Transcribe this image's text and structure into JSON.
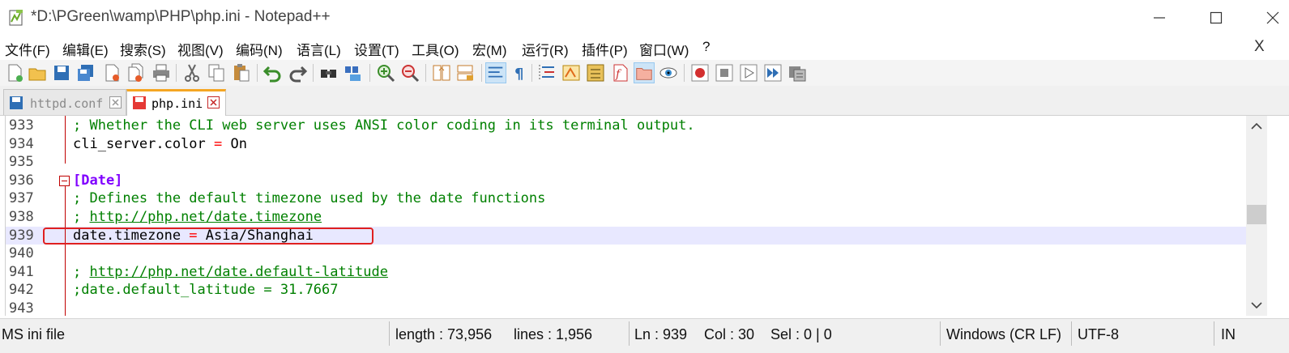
{
  "window": {
    "title": "*D:\\PGreen\\wamp\\PHP\\php.ini - Notepad++",
    "minimize_glyph": "—",
    "maximize_glyph": "☐",
    "close_glyph": "✕"
  },
  "menu": {
    "items": [
      "文件(F)",
      "编辑(E)",
      "搜索(S)",
      "视图(V)",
      "编码(N)",
      "语言(L)",
      "设置(T)",
      "工具(O)",
      "宏(M)",
      "运行(R)",
      "插件(P)",
      "窗口(W)",
      "?"
    ],
    "close_label": "X"
  },
  "toolbar": {
    "buttons": [
      "new-file-icon",
      "open-file-icon",
      "save-icon",
      "save-all-icon",
      "close-icon",
      "close-all-icon",
      "print-icon",
      "cut-icon",
      "copy-icon",
      "paste-icon",
      "undo-icon",
      "redo-icon",
      "find-icon",
      "replace-icon",
      "zoom-in-icon",
      "zoom-out-icon",
      "sync-vertical-icon",
      "sync-horizontal-icon",
      "word-wrap-icon",
      "show-all-chars-icon",
      "indent-guide-icon",
      "user-language-icon",
      "function-list-icon",
      "document-map-icon",
      "folder-workspace-icon",
      "monitoring-icon",
      "record-macro-icon",
      "stop-macro-icon",
      "play-macro-icon",
      "run-macro-multiple-icon",
      "save-macro-icon"
    ]
  },
  "tabs": [
    {
      "label": "httpd.conf",
      "active": false
    },
    {
      "label": "php.ini",
      "active": true
    }
  ],
  "editor": {
    "lines": [
      {
        "num": "933",
        "parts": [
          {
            "t": "; Whether the CLI web server uses ANSI color coding in its terminal output.",
            "c": "c-comment"
          }
        ]
      },
      {
        "num": "934",
        "parts": [
          {
            "t": "cli_server.color ",
            "c": "c-key"
          },
          {
            "t": "=",
            "c": "c-eq"
          },
          {
            "t": " On",
            "c": "c-val"
          }
        ]
      },
      {
        "num": "935",
        "parts": []
      },
      {
        "num": "936",
        "parts": [
          {
            "t": "[Date]",
            "c": "c-section"
          }
        ]
      },
      {
        "num": "937",
        "parts": [
          {
            "t": "; Defines the default timezone used by the date functions",
            "c": "c-comment"
          }
        ]
      },
      {
        "num": "938",
        "parts": [
          {
            "t": "; ",
            "c": "c-comment"
          },
          {
            "t": "http://php.net/date.timezone",
            "c": "c-link"
          }
        ]
      },
      {
        "num": "939",
        "parts": [
          {
            "t": "date.timezone ",
            "c": "c-key"
          },
          {
            "t": "=",
            "c": "c-eq"
          },
          {
            "t": " Asia/Shanghai",
            "c": "c-val"
          }
        ]
      },
      {
        "num": "940",
        "parts": []
      },
      {
        "num": "941",
        "parts": [
          {
            "t": "; ",
            "c": "c-comment"
          },
          {
            "t": "http://php.net/date.default-latitude",
            "c": "c-link"
          }
        ]
      },
      {
        "num": "942",
        "parts": [
          {
            "t": ";date.default_latitude = 31.7667",
            "c": "c-comment"
          }
        ]
      },
      {
        "num": "943",
        "parts": []
      }
    ],
    "current_line": "939"
  },
  "statusbar": {
    "file_type": "MS ini file",
    "length": "length : 73,956",
    "lines": "lines : 1,956",
    "ln": "Ln : 939",
    "col": "Col : 30",
    "sel": "Sel : 0 | 0",
    "eol": "Windows (CR LF)",
    "encoding": "UTF-8",
    "insert_mode": "IN"
  },
  "colors": {
    "comment": "#008000",
    "section": "#8000ff",
    "operator": "#ff0000",
    "current_line": "#e8e8ff",
    "active_tab_accent": "#f5a623",
    "annotation": "#e02020"
  }
}
